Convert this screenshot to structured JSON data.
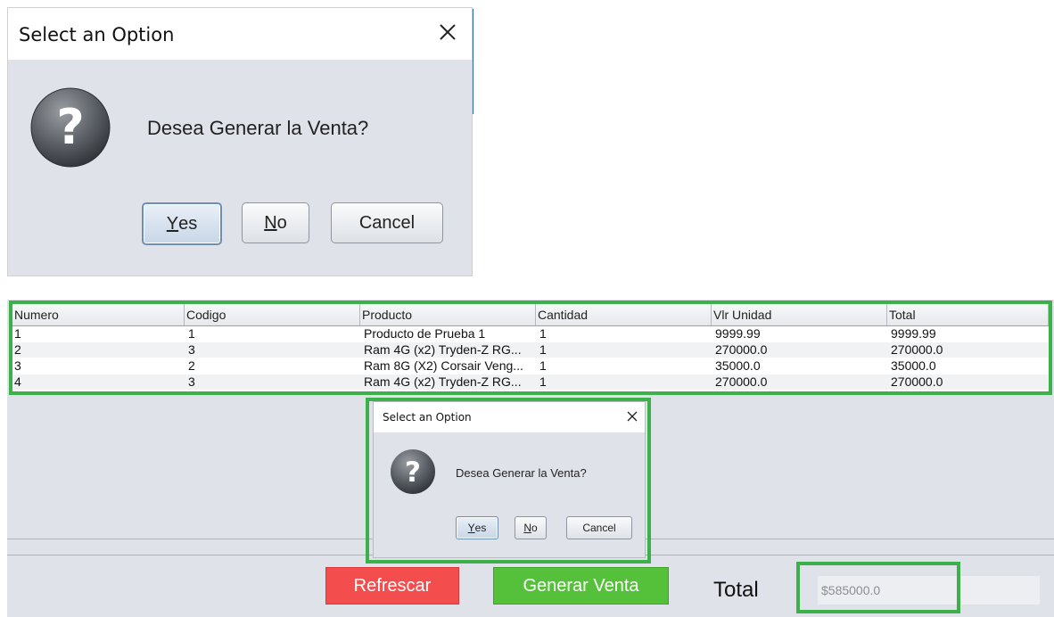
{
  "enlarged_dialog": {
    "title": "Select an Option",
    "close_glyph": "×",
    "icon": "question-icon",
    "message": "Desea Generar la Venta?",
    "buttons": {
      "yes": {
        "mnemonic": "Y",
        "rest": "es"
      },
      "no": {
        "mnemonic": "N",
        "rest": "o"
      },
      "cancel": "Cancel"
    }
  },
  "table": {
    "columns": [
      "Numero",
      "Codigo",
      "Producto",
      "Cantidad",
      "Vlr Unidad",
      "Total"
    ],
    "rows": [
      [
        "1",
        "1",
        "Producto de Prueba 1",
        "1",
        "9999.99",
        "9999.99"
      ],
      [
        "2",
        "3",
        "Ram 4G (x2) Tryden-Z RG...",
        "1",
        "270000.0",
        "270000.0"
      ],
      [
        "3",
        "2",
        "Ram 8G (X2) Corsair Veng...",
        "1",
        "35000.0",
        "35000.0"
      ],
      [
        "4",
        "3",
        "Ram 4G (x2) Tryden-Z RG...",
        "1",
        "270000.0",
        "270000.0"
      ]
    ]
  },
  "dialog": {
    "title": "Select an Option",
    "message": "Desea Generar la Venta?",
    "icon": "question-icon",
    "buttons": {
      "yes": {
        "mnemonic": "Y",
        "rest": "es"
      },
      "no": {
        "mnemonic": "N",
        "rest": "o"
      },
      "cancel": "Cancel"
    }
  },
  "actions": {
    "refresh_label": "Refrescar",
    "generate_label": "Generar Venta"
  },
  "total": {
    "label": "Total",
    "value": "$585000.0"
  },
  "colors": {
    "highlight": "#3cb14a",
    "refresh_button": "#f34d4d",
    "generate_button": "#55c13a",
    "dialog_body": "#dfe2e8"
  }
}
